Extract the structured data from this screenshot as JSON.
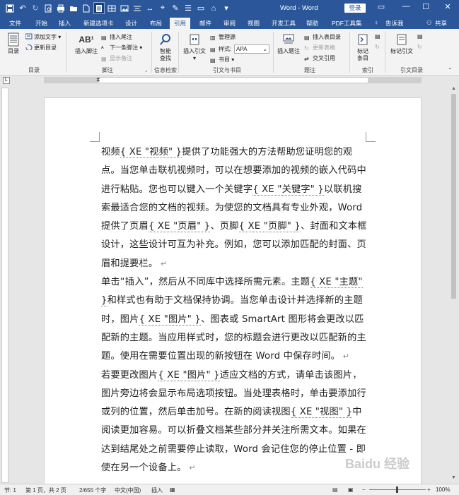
{
  "window": {
    "title": "Word - Word",
    "login_label": "登录"
  },
  "tabs": [
    "文件",
    "开始",
    "插入",
    "新建选项卡",
    "设计",
    "布局",
    "引用",
    "邮件",
    "审阅",
    "视图",
    "开发工具",
    "帮助",
    "PDF工具集"
  ],
  "tell_me": "告诉我",
  "share": "共享",
  "ribbon": {
    "toc": {
      "big": "目录",
      "add_text": "添加文字",
      "update": "更新目录",
      "group": "目录"
    },
    "footnotes": {
      "insert_footnote": "插入脚注",
      "insert_endnote": "插入尾注",
      "next_footnote": "下一条脚注",
      "show_notes": "显示备注",
      "group": "脚注",
      "ab_glyph": "AB¹"
    },
    "research": {
      "smart_lookup": "智能查找",
      "group": "信息检索"
    },
    "citations": {
      "insert_citation": "插入引文",
      "manage_sources": "管理源",
      "style_label": "样式:",
      "style_value": "APA",
      "bibliography": "书目",
      "group": "引文与书目"
    },
    "captions": {
      "insert_caption": "插入题注",
      "insert_tof": "插入表目录",
      "update_table": "更新表格",
      "cross_ref": "交叉引用",
      "group": "题注"
    },
    "index": {
      "mark_entry": "标记条目",
      "group": "索引"
    },
    "toa": {
      "mark_citation": "标记引文",
      "group": "引文目录"
    }
  },
  "document": {
    "paragraphs": [
      [
        {
          "t": "视频"
        },
        {
          "t": "{ XE \"视频\" }",
          "xe": true
        },
        {
          "t": "提供了功能强大的方法帮助您证明您的观点。当您单击联机视频时，可以在想要添加的视频的嵌入代码中进行粘贴。您也可以键入一个关键字"
        },
        {
          "t": "{ XE \"关键字\" }",
          "xe": true
        },
        {
          "t": "以联机搜索最适合您的文档的视频。为使您的文档具有专业外观，Word 提供了页眉"
        },
        {
          "t": "{ XE \"页眉\" }",
          "xe": true
        },
        {
          "t": "、页脚"
        },
        {
          "t": "{ XE \"页脚\" }",
          "xe": true
        },
        {
          "t": "、封面和文本框设计，这些设计可互为补充。例如，您可以添加匹配的封面、页眉和提要栏。"
        }
      ],
      [
        {
          "t": "单击“插入”，然后从不同库中选择所需元素。主题"
        },
        {
          "t": "{ XE \"主题\" }",
          "xe": true
        },
        {
          "t": "和样式也有助于文档保持协调。当您单击设计并选择新的主题时，图片"
        },
        {
          "t": "{ XE \"图片\" }",
          "xe": true
        },
        {
          "t": "、图表或 SmartArt 图形将会更改以匹配新的主题。当应用样式时，您的标题会进行更改以匹配新的主题。使用在需要位置出现的新按钮在 Word 中保存时间。"
        }
      ],
      [
        {
          "t": "若要更改图片"
        },
        {
          "t": "{ XE \"图片\" }",
          "xe": true
        },
        {
          "t": "适应文档的方式，请单击该图片，图片旁边将会显示布局选项按钮。当处理表格时，单击要添加行或列的位置，然后单击加号。在新的阅读视图"
        },
        {
          "t": "{ XE \"视图\" }",
          "xe": true
        },
        {
          "t": "中阅读更加容易。可以折叠文档某些部分并关注所需文本。如果在达到结尾处之前需要停止读取，Word 会记住您的停止位置 - 即使在另一个设备上。"
        }
      ]
    ],
    "para_mark": "↵"
  },
  "status": {
    "section": "节: 1",
    "page": "第 1 页，共 2 页",
    "words": "2/655 个字",
    "lang": "中文(中国)",
    "mode": "插入",
    "zoom": "100%"
  },
  "watermark": "Baidu 经验"
}
